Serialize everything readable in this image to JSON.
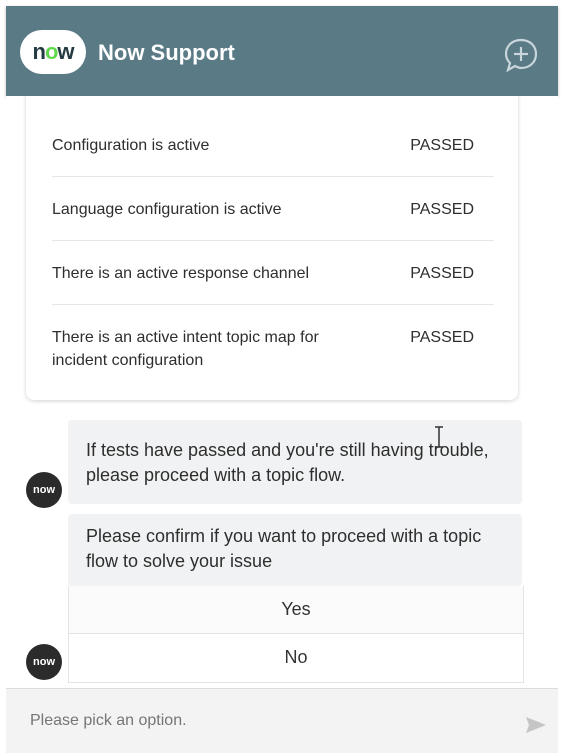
{
  "header": {
    "logo_text_pre": "n",
    "logo_text_o": "o",
    "logo_text_post": "w",
    "title": "Now Support",
    "new_chat_icon": "chat-plus-icon"
  },
  "checks": [
    {
      "label": "Configuration is active",
      "status": "PASSED"
    },
    {
      "label": "Language configuration is active",
      "status": "PASSED"
    },
    {
      "label": "There is an active response channel",
      "status": "PASSED"
    },
    {
      "label": "There is an active intent topic map for incident configuration",
      "status": "PASSED"
    }
  ],
  "messages": {
    "avatar_label": "now",
    "msg1": "If tests have passed and you're still having trouble, please proceed with a topic flow.",
    "msg2": "Please confirm if you want to proceed with a topic flow to solve your issue"
  },
  "options": [
    "Yes",
    "No"
  ],
  "footer": {
    "placeholder": "Please pick an option.",
    "send_icon": "send-icon"
  },
  "colors": {
    "header_bg": "#5a7a86",
    "logo_o": "#62d84e",
    "bubble_bg": "#f1f2f3",
    "avatar_bg": "#2b2b2b"
  }
}
